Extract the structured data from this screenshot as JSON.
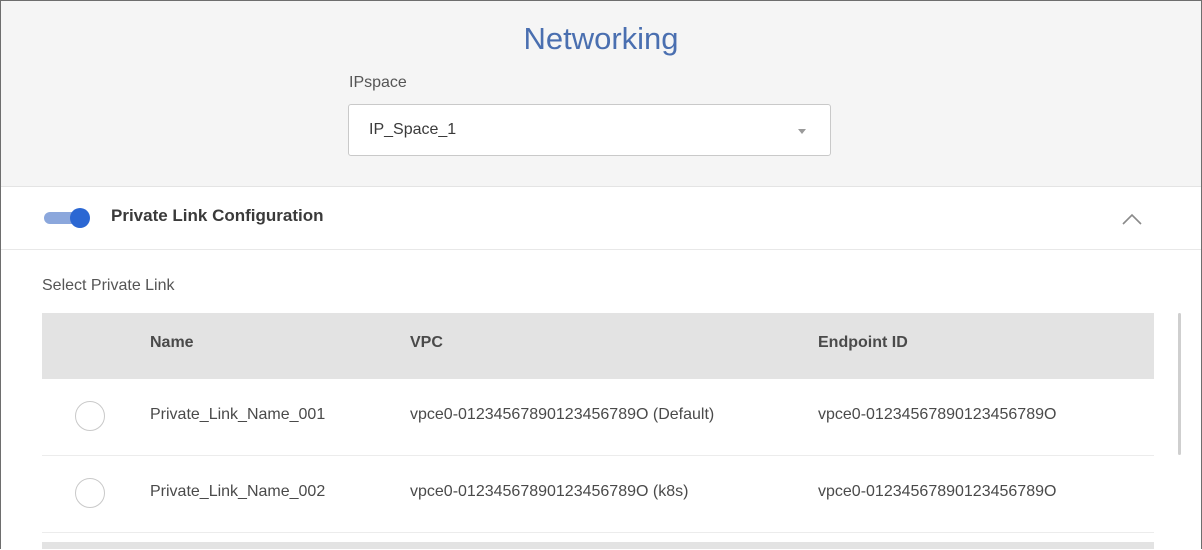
{
  "networking": {
    "title": "Networking",
    "ipspace_label": "IPspace",
    "ipspace_value": "IP_Space_1"
  },
  "private_link": {
    "toggle_on": true,
    "title": "Private Link Configuration",
    "select_label": "Select Private Link",
    "columns": [
      "Name",
      "VPC",
      "Endpoint ID"
    ],
    "rows": [
      {
        "name": "Private_Link_Name_001",
        "vpc": "vpce0-01234567890123456789O (Default)",
        "endpoint": "vpce0-01234567890123456789O",
        "selected": false
      },
      {
        "name": "Private_Link_Name_002",
        "vpc": "vpce0-01234567890123456789O (k8s)",
        "endpoint": "vpce0-01234567890123456789O",
        "selected": false
      }
    ]
  },
  "icons": {
    "select_caret": "chevron-down-icon",
    "collapse": "chevron-up-icon"
  },
  "colors": {
    "accent": "#2b67d3",
    "title": "#4a6fb0"
  }
}
